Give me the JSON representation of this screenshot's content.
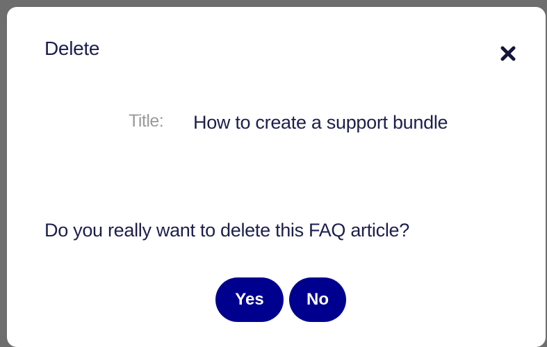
{
  "dialog": {
    "title": "Delete",
    "close_icon": "close-icon",
    "field": {
      "label": "Title:",
      "value": "How to create a support bundle"
    },
    "question": "Do you really want to delete this FAQ article?",
    "buttons": {
      "yes": "Yes",
      "no": "No"
    },
    "colors": {
      "text": "#1c1f4c",
      "label": "#9a9a9a",
      "button": "#00008f"
    }
  }
}
